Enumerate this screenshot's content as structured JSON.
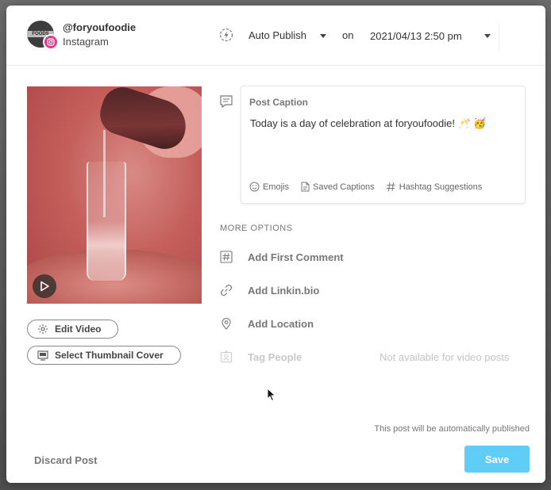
{
  "account": {
    "handle": "@foryoufoodie",
    "network": "Instagram",
    "avatar_text": "FOODS"
  },
  "publish": {
    "mode": "Auto Publish",
    "on_label": "on",
    "datetime": "2021/04/13 2:50 pm"
  },
  "media": {
    "edit_video_label": "Edit Video",
    "thumbnail_label": "Select Thumbnail Cover"
  },
  "caption": {
    "label": "Post Caption",
    "text": "Today is a day of celebration at foryoufoodie! 🥂 🥳",
    "tools": {
      "emojis": "Emojis",
      "saved_captions": "Saved Captions",
      "hashtag_suggestions": "Hashtag Suggestions"
    }
  },
  "more_options": {
    "heading": "MORE OPTIONS",
    "first_comment": "Add First Comment",
    "linkin_bio": "Add Linkin.bio",
    "location": "Add Location",
    "tag_people": "Tag People",
    "tag_people_note": "Not available for video posts"
  },
  "footer": {
    "status": "This post will be automatically published",
    "discard_label": "Discard Post",
    "save_label": "Save"
  },
  "colors": {
    "save_button": "#5fcdf6",
    "instagram_badge": "#d63384"
  }
}
